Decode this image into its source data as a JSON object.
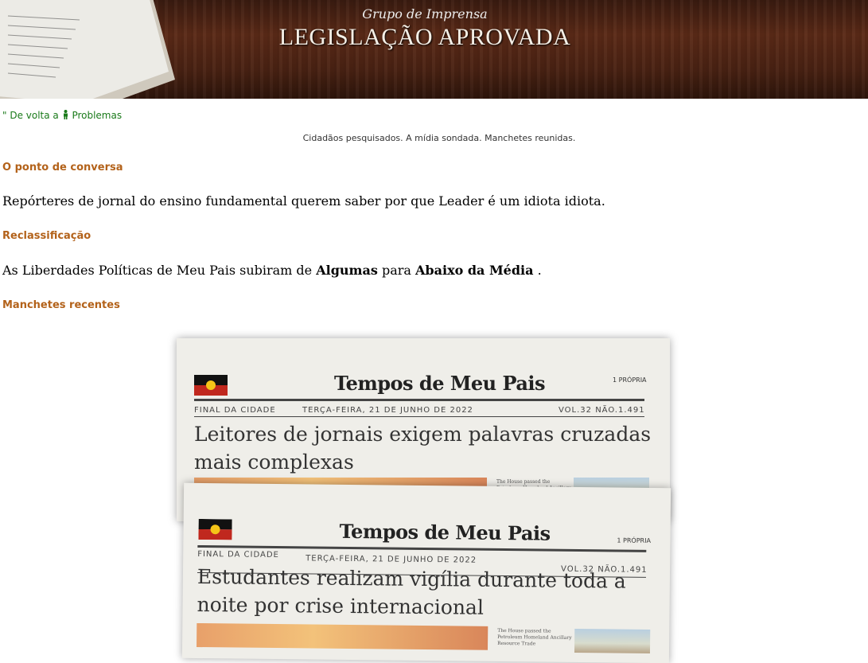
{
  "banner": {
    "subtitle": "Grupo de Imprensa",
    "title": "LEGISLAÇÃO APROVADA"
  },
  "nav": {
    "back_prefix": "\" De volta a",
    "back_link": "Problemas"
  },
  "tagline": "Cidadãos pesquisados. A mídia sondada. Manchetes reunidas.",
  "talking_point": {
    "heading": "O ponto de conversa",
    "text": "Repórteres de jornal do ensino fundamental querem saber por que Leader é um idiota idiota."
  },
  "reclassification": {
    "heading": "Reclassificação",
    "prefix": "As Liberdades Políticas de Meu Pais subiram de",
    "from": "Algumas",
    "middle": "para",
    "to": "Abaixo da Média",
    "suffix": "."
  },
  "recent": {
    "heading": "Manchetes recentes",
    "papers": [
      {
        "masthead": "Tempos de Meu Pais",
        "edition": "1 PRÓPRIA",
        "city": "FINAL DA CIDADE",
        "date": "TERÇA-FEIRA, 21 DE JUNHO DE 2022",
        "volume": "VOL.32 NÃO.1.491",
        "headline_line1": "Leitores de jornais exigem palavras cruzadas",
        "headline_line2": "mais complexas",
        "body": "The House passed the Petroleum Homeland Ancillary Resource Trade bill yesterday by a narrow margin of a"
      },
      {
        "masthead": "Tempos de Meu Pais",
        "edition": "1 PRÓPRIA",
        "city": "FINAL DA CIDADE",
        "date": "TERÇA-FEIRA, 21 DE JUNHO DE 2022",
        "volume": "VOL.32 NÃO.1.491",
        "headline_line1": "Estudantes realizam vigília durante toda a",
        "headline_line2": "noite por crise internacional",
        "body": "The House passed the Petroleum Homeland Ancillary Resource Trade"
      }
    ]
  }
}
